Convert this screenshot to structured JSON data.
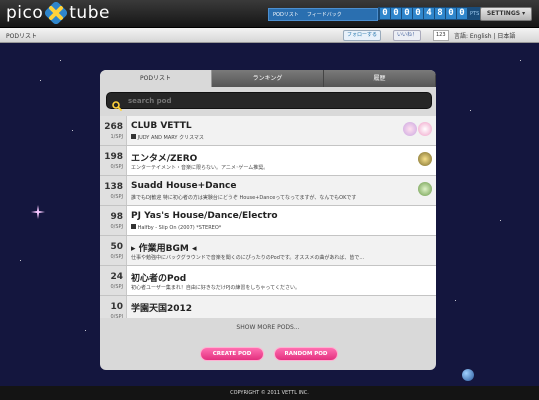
{
  "header": {
    "logo_left": "pico",
    "logo_right": "tube",
    "nav": [
      "PODリスト",
      "フィードバック"
    ],
    "points_digits": [
      "0",
      "0",
      "0",
      "0",
      "4",
      "8",
      "0",
      "0"
    ],
    "points_label": "PTS",
    "settings_label": "SETTINGS ▾"
  },
  "subbar": {
    "breadcrumb": "PODリスト",
    "follow_label": "フォローする",
    "like_label": "いいね！",
    "like_count": "123",
    "language": "言語: English | 日本語"
  },
  "tabs": [
    "PODリスト",
    "ランキング",
    "履歴"
  ],
  "search": {
    "placeholder": "search pod",
    "value": ""
  },
  "pods": [
    {
      "count": "268",
      "spj": "1/SPJ",
      "title": "CLUB VETTL",
      "sub": "JUDY AND MARY  クリスマス"
    },
    {
      "count": "198",
      "spj": "0/SPJ",
      "title": "エンタメ/ZERO",
      "sub": "エンターテイメント・音楽に限らない。アニメ･ゲーム推奨。"
    },
    {
      "count": "138",
      "spj": "0/SPJ",
      "title": "Suadd House+Dance",
      "sub": "誰でもDJ歓迎 特に初心者の方は実験台にどうぞ House+Danceってなってますが、なんでもOKです"
    },
    {
      "count": "98",
      "spj": "0/SPJ",
      "title": "PJ Yas's House/Dance/Electro",
      "sub": "Halfby - Slip On (2007) *STEREO*"
    },
    {
      "count": "50",
      "spj": "0/SPJ",
      "title": "▸ 作業用BGM ◂",
      "sub": "仕事や勉強中にバックグラウンドで音楽を聞くのにぴったりのPodです。オススメの曲があれば、皆で..."
    },
    {
      "count": "24",
      "spj": "0/SPJ",
      "title": "初心者のPod",
      "sub": "初心者ユーザー集まれ！自由に好きなだけPJの練習をしちゃってください。"
    },
    {
      "count": "10",
      "spj": "0/SPJ",
      "title": "学園天国2012",
      "sub": ""
    }
  ],
  "more_label": "SHOW MORE PODS...",
  "buttons": {
    "create": "CREATE POD",
    "random": "RANDOM POD"
  },
  "footer": "COPYRIGHT © 2011 VETTL INC.",
  "colors": {
    "accent_pink": "#e3307f",
    "nav_blue": "#2a6fb0",
    "space_bg": "#14163e"
  }
}
